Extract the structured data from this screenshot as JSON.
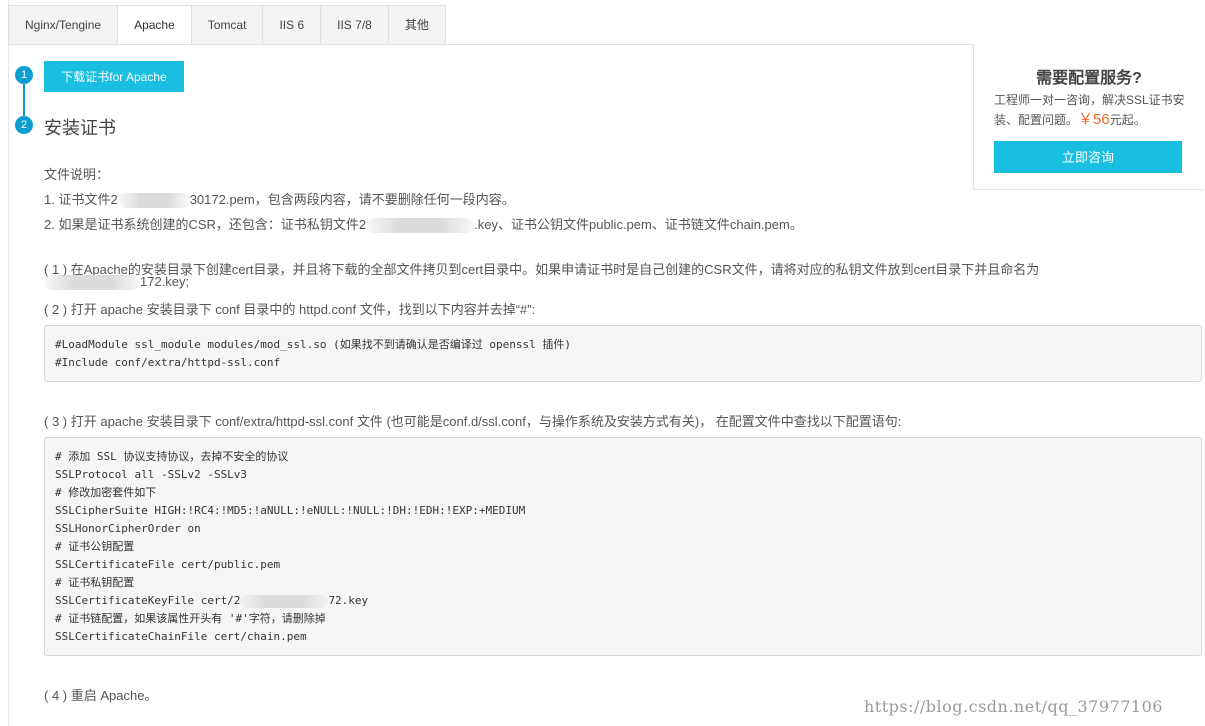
{
  "tabs": [
    {
      "label": "Nginx/Tengine",
      "active": false
    },
    {
      "label": "Apache",
      "active": true
    },
    {
      "label": "Tomcat",
      "active": false
    },
    {
      "label": "IIS 6",
      "active": false
    },
    {
      "label": "IIS 7/8",
      "active": false
    },
    {
      "label": "其他",
      "active": false
    }
  ],
  "steps": {
    "one_number": "1",
    "download_button": "下载证书for Apache",
    "two_number": "2",
    "two_title": "安装证书"
  },
  "side_panel": {
    "title": "需要配置服务?",
    "desc_pre": "工程师一对一咨询，解决SSL证书安装、配置问题。",
    "price": "￥56",
    "desc_post": "元起。",
    "consult_button": "立即咨询"
  },
  "file_desc": {
    "heading": "文件说明：",
    "line1_pre": "1. 证书文件2",
    "line1_post": "30172.pem，包含两段内容，请不要删除任何一段内容。",
    "line2_pre": "2. 如果是证书系统创建的CSR，还包含：证书私钥文件2",
    "line2_post": ".key、证书公钥文件public.pem、证书链文件chain.pem。"
  },
  "instructions": {
    "step1_line1": "( 1 ) 在Apache的安装目录下创建cert目录，并且将下载的全部文件拷贝到cert目录中。如果申请证书时是自己创建的CSR文件，请将对应的私钥文件放到cert目录下并且命名为",
    "step1_line2": "172.key;",
    "step2": "( 2 ) 打开 apache 安装目录下 conf 目录中的 httpd.conf 文件，找到以下内容并去掉“#”:",
    "step3": "( 3 ) 打开 apache 安装目录下 conf/extra/httpd-ssl.conf 文件 (也可能是conf.d/ssl.conf，与操作系统及安装方式有关)， 在配置文件中查找以下配置语句:",
    "step4": "( 4 ) 重启 Apache。"
  },
  "code_block_1": [
    "#LoadModule ssl_module modules/mod_ssl.so (如果找不到请确认是否编译过 openssl 插件)",
    "#Include conf/extra/httpd-ssl.conf"
  ],
  "code_block_2": {
    "lines_a": [
      "# 添加 SSL 协议支持协议，去掉不安全的协议",
      "SSLProtocol all -SSLv2 -SSLv3",
      "# 修改加密套件如下",
      "SSLCipherSuite HIGH:!RC4:!MD5:!aNULL:!eNULL:!NULL:!DH:!EDH:!EXP:+MEDIUM",
      "SSLHonorCipherOrder on",
      "# 证书公钥配置",
      "SSLCertificateFile cert/public.pem",
      "# 证书私钥配置"
    ],
    "key_line_pre": "SSLCertificateKeyFile cert/2",
    "key_line_post": "72.key",
    "lines_b": [
      "# 证书链配置，如果该属性开头有 '#'字符，请删除掉",
      "SSLCertificateChainFile cert/chain.pem"
    ]
  },
  "watermark": "https://blog.csdn.net/qq_37977106"
}
